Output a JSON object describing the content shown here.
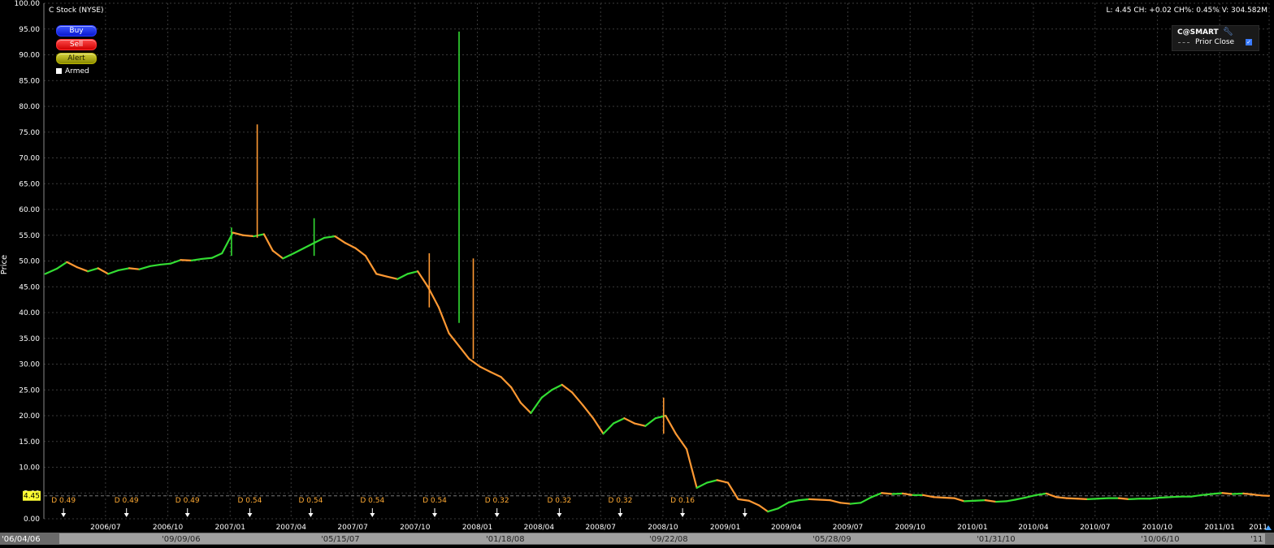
{
  "window": {
    "title": "C Stock (NYSE)",
    "stats": "L: 4.45 CH: +0.02 CH%: 0.45% V: 304.582M"
  },
  "order_panel": {
    "buy_label": "Buy",
    "sell_label": "Sell",
    "alert_label": "Alert",
    "armed_label": "Armed"
  },
  "legend": {
    "source_label": "C@SMART",
    "prior_close_label": "Prior Close",
    "prior_close_checked": true
  },
  "price_tag": "4.45",
  "colors": {
    "up": "#33dd33",
    "down": "#ff9933",
    "grid": "#3a3a3a",
    "dividend": "#ffaa33",
    "price_tag_bg": "#ffff33"
  },
  "chart_data": {
    "type": "line",
    "title": "C Stock (NYSE)",
    "ylabel": "Price",
    "xlabel": "",
    "ylim": [
      0,
      100
    ],
    "yticks": [
      "0.00",
      "5.00",
      "10.00",
      "15.00",
      "20.00",
      "25.00",
      "30.00",
      "35.00",
      "40.00",
      "45.00",
      "50.00",
      "55.00",
      "60.00",
      "65.00",
      "70.00",
      "75.00",
      "80.00",
      "85.00",
      "90.00",
      "95.00",
      "100.00"
    ],
    "xlim": [
      "2006-04-01",
      "2011-03-15"
    ],
    "xticks": [
      {
        "date": "2006-07-01",
        "label": "2006/07"
      },
      {
        "date": "2006-10-01",
        "label": "2006/10"
      },
      {
        "date": "2007-01-01",
        "label": "2007/01"
      },
      {
        "date": "2007-04-01",
        "label": "2007/04"
      },
      {
        "date": "2007-07-01",
        "label": "2007/07"
      },
      {
        "date": "2007-10-01",
        "label": "2007/10"
      },
      {
        "date": "2008-01-01",
        "label": "2008/01"
      },
      {
        "date": "2008-04-01",
        "label": "2008/04"
      },
      {
        "date": "2008-07-01",
        "label": "2008/07"
      },
      {
        "date": "2008-10-01",
        "label": "2008/10"
      },
      {
        "date": "2009-01-01",
        "label": "2009/01"
      },
      {
        "date": "2009-04-01",
        "label": "2009/04"
      },
      {
        "date": "2009-07-01",
        "label": "2009/07"
      },
      {
        "date": "2009-10-01",
        "label": "2009/10"
      },
      {
        "date": "2010-01-01",
        "label": "2010/01"
      },
      {
        "date": "2010-04-01",
        "label": "2010/04"
      },
      {
        "date": "2010-07-01",
        "label": "2010/07"
      },
      {
        "date": "2010-10-01",
        "label": "2010/10"
      },
      {
        "date": "2011-01-01",
        "label": "2011/01"
      },
      {
        "date": "2011-03-15",
        "label": "2011"
      }
    ],
    "scroll_labels": [
      "'06/04/06",
      "'09/09/06",
      "'05/15/07",
      "'01/18/08",
      "'09/22/08",
      "'05/28/09",
      "'01/31/10",
      "'10/06/10",
      "'11"
    ],
    "series": [
      {
        "values": [
          [
            "2006-04-03",
            47.5
          ],
          [
            "2006-04-20",
            48.5
          ],
          [
            "2006-05-05",
            49.8
          ],
          [
            "2006-05-20",
            48.8
          ],
          [
            "2006-06-05",
            48.0
          ],
          [
            "2006-06-20",
            48.6
          ],
          [
            "2006-07-05",
            47.5
          ],
          [
            "2006-07-20",
            48.2
          ],
          [
            "2006-08-05",
            48.6
          ],
          [
            "2006-08-20",
            48.4
          ],
          [
            "2006-09-05",
            49.0
          ],
          [
            "2006-09-20",
            49.3
          ],
          [
            "2006-10-05",
            49.5
          ],
          [
            "2006-10-20",
            50.2
          ],
          [
            "2006-11-05",
            50.1
          ],
          [
            "2006-11-20",
            50.4
          ],
          [
            "2006-12-05",
            50.6
          ],
          [
            "2006-12-20",
            51.5
          ],
          [
            "2007-01-05",
            55.5
          ],
          [
            "2007-01-20",
            55.0
          ],
          [
            "2007-02-05",
            54.8
          ],
          [
            "2007-02-20",
            55.2
          ],
          [
            "2007-03-05",
            52.0
          ],
          [
            "2007-03-20",
            50.5
          ],
          [
            "2007-04-05",
            51.5
          ],
          [
            "2007-04-20",
            52.5
          ],
          [
            "2007-05-05",
            53.5
          ],
          [
            "2007-05-20",
            54.5
          ],
          [
            "2007-06-05",
            54.8
          ],
          [
            "2007-06-20",
            53.5
          ],
          [
            "2007-07-05",
            52.5
          ],
          [
            "2007-07-20",
            51.0
          ],
          [
            "2007-08-05",
            47.5
          ],
          [
            "2007-08-20",
            47.0
          ],
          [
            "2007-09-05",
            46.5
          ],
          [
            "2007-09-20",
            47.5
          ],
          [
            "2007-10-05",
            48.0
          ],
          [
            "2007-10-20",
            45.0
          ],
          [
            "2007-11-05",
            41.0
          ],
          [
            "2007-11-20",
            36.0
          ],
          [
            "2007-12-05",
            33.5
          ],
          [
            "2007-12-20",
            31.0
          ],
          [
            "2008-01-05",
            29.5
          ],
          [
            "2008-01-20",
            28.5
          ],
          [
            "2008-02-05",
            27.5
          ],
          [
            "2008-02-20",
            25.5
          ],
          [
            "2008-03-05",
            22.5
          ],
          [
            "2008-03-20",
            20.5
          ],
          [
            "2008-04-05",
            23.5
          ],
          [
            "2008-04-20",
            25.0
          ],
          [
            "2008-05-05",
            26.0
          ],
          [
            "2008-05-20",
            24.5
          ],
          [
            "2008-06-05",
            22.0
          ],
          [
            "2008-06-20",
            19.5
          ],
          [
            "2008-07-05",
            16.5
          ],
          [
            "2008-07-20",
            18.5
          ],
          [
            "2008-08-05",
            19.5
          ],
          [
            "2008-08-20",
            18.5
          ],
          [
            "2008-09-05",
            18.0
          ],
          [
            "2008-09-20",
            19.5
          ],
          [
            "2008-10-05",
            20.0
          ],
          [
            "2008-10-20",
            16.5
          ],
          [
            "2008-11-05",
            13.5
          ],
          [
            "2008-11-20",
            6.0
          ],
          [
            "2008-12-05",
            7.0
          ],
          [
            "2008-12-20",
            7.5
          ],
          [
            "2009-01-05",
            7.0
          ],
          [
            "2009-01-20",
            3.8
          ],
          [
            "2009-02-05",
            3.5
          ],
          [
            "2009-02-20",
            2.6
          ],
          [
            "2009-03-05",
            1.4
          ],
          [
            "2009-03-20",
            2.0
          ],
          [
            "2009-04-05",
            3.2
          ],
          [
            "2009-04-20",
            3.6
          ],
          [
            "2009-05-05",
            3.8
          ],
          [
            "2009-05-20",
            3.7
          ],
          [
            "2009-06-05",
            3.6
          ],
          [
            "2009-06-20",
            3.1
          ],
          [
            "2009-07-05",
            2.9
          ],
          [
            "2009-07-20",
            3.1
          ],
          [
            "2009-08-05",
            4.2
          ],
          [
            "2009-08-20",
            5.0
          ],
          [
            "2009-09-05",
            4.8
          ],
          [
            "2009-09-20",
            4.9
          ],
          [
            "2009-10-05",
            4.6
          ],
          [
            "2009-10-20",
            4.6
          ],
          [
            "2009-11-05",
            4.2
          ],
          [
            "2009-11-20",
            4.1
          ],
          [
            "2009-12-05",
            4.0
          ],
          [
            "2009-12-20",
            3.4
          ],
          [
            "2010-01-05",
            3.5
          ],
          [
            "2010-01-20",
            3.6
          ],
          [
            "2010-02-05",
            3.3
          ],
          [
            "2010-02-20",
            3.4
          ],
          [
            "2010-03-05",
            3.7
          ],
          [
            "2010-03-20",
            4.1
          ],
          [
            "2010-04-05",
            4.6
          ],
          [
            "2010-04-20",
            4.9
          ],
          [
            "2010-05-05",
            4.2
          ],
          [
            "2010-05-20",
            4.0
          ],
          [
            "2010-06-05",
            3.9
          ],
          [
            "2010-06-20",
            3.8
          ],
          [
            "2010-07-05",
            3.9
          ],
          [
            "2010-07-20",
            4.0
          ],
          [
            "2010-08-05",
            4.0
          ],
          [
            "2010-08-20",
            3.8
          ],
          [
            "2010-09-05",
            3.9
          ],
          [
            "2010-09-20",
            3.9
          ],
          [
            "2010-10-05",
            4.1
          ],
          [
            "2010-10-20",
            4.2
          ],
          [
            "2010-11-05",
            4.3
          ],
          [
            "2010-11-20",
            4.3
          ],
          [
            "2010-12-05",
            4.6
          ],
          [
            "2010-12-20",
            4.8
          ],
          [
            "2011-01-05",
            5.0
          ],
          [
            "2011-01-20",
            4.8
          ],
          [
            "2011-02-05",
            4.9
          ],
          [
            "2011-02-20",
            4.7
          ],
          [
            "2011-03-05",
            4.5
          ],
          [
            "2011-03-15",
            4.45
          ]
        ]
      }
    ],
    "spikes": [
      {
        "date": "2007-02-10",
        "low": 54.5,
        "high": 76.5,
        "color": "down"
      },
      {
        "date": "2007-12-05",
        "low": 38.0,
        "high": 94.5,
        "color": "up"
      },
      {
        "date": "2007-12-26",
        "low": 31.0,
        "high": 50.5,
        "color": "down"
      },
      {
        "date": "2007-10-22",
        "low": 41.0,
        "high": 51.5,
        "color": "down"
      },
      {
        "date": "2007-01-03",
        "low": 51.0,
        "high": 56.5,
        "color": "up"
      },
      {
        "date": "2007-05-05",
        "low": 51.0,
        "high": 58.3,
        "color": "up"
      },
      {
        "date": "2008-10-02",
        "low": 16.5,
        "high": 23.5,
        "color": "down"
      }
    ],
    "dividends": [
      {
        "date": "2006-04-30",
        "label": "D 0.49"
      },
      {
        "date": "2006-08-01",
        "label": "D 0.49"
      },
      {
        "date": "2006-10-30",
        "label": "D 0.49"
      },
      {
        "date": "2007-01-30",
        "label": "D 0.54"
      },
      {
        "date": "2007-04-30",
        "label": "D 0.54"
      },
      {
        "date": "2007-07-30",
        "label": "D 0.54"
      },
      {
        "date": "2007-10-30",
        "label": "D 0.54"
      },
      {
        "date": "2008-01-30",
        "label": "D 0.32"
      },
      {
        "date": "2008-05-01",
        "label": "D 0.32"
      },
      {
        "date": "2008-07-30",
        "label": "D 0.32"
      },
      {
        "date": "2008-10-30",
        "label": "D 0.16"
      },
      {
        "date": "2009-01-30",
        "label": ""
      }
    ],
    "prior_close": 4.45
  }
}
